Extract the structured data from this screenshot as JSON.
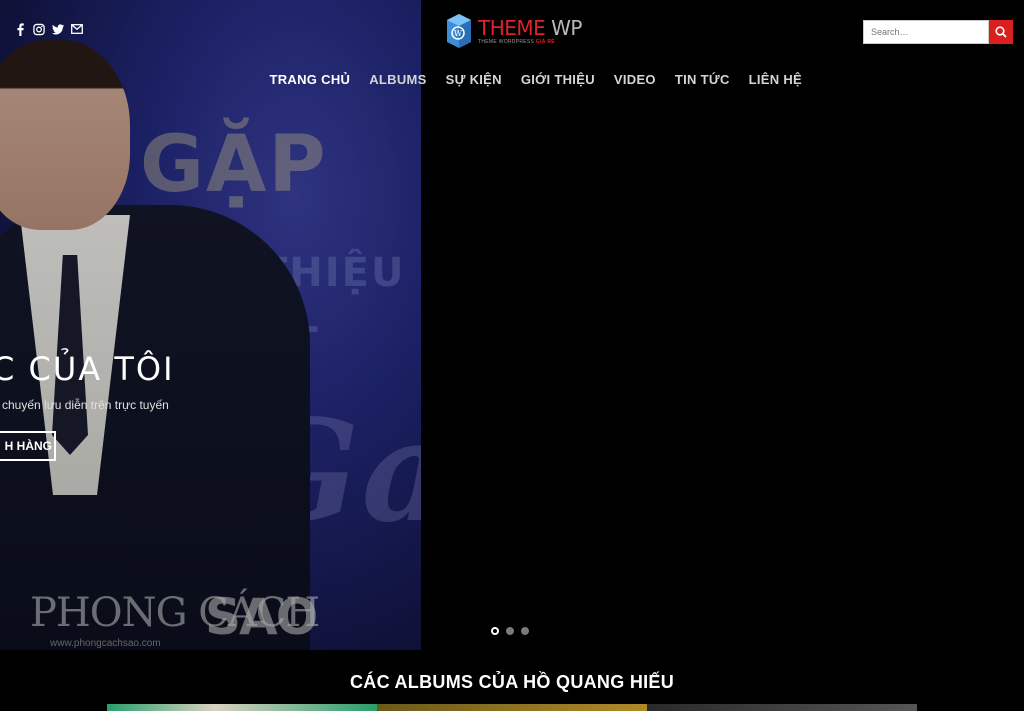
{
  "social": {
    "icons": [
      "facebook-icon",
      "instagram-icon",
      "twitter-icon",
      "email-icon"
    ]
  },
  "logo": {
    "name_theme": "THEME",
    "name_wp": "WP",
    "tagline_prefix": "THEME WORDPRESS",
    "tagline_accent": "GIÁ RẺ"
  },
  "search": {
    "placeholder": "Search…"
  },
  "nav": {
    "items": [
      "TRANG CHỦ",
      "ALBUMS",
      "SỰ KIỆN",
      "GIỚI THIỆU",
      "VIDEO",
      "TIN TỨC",
      "LIÊN HỆ"
    ],
    "active_index": 0
  },
  "slide": {
    "backdrop_text_1": "GẶP G",
    "backdrop_text_2": "THIỆU AL",
    "title": "C CỦA TÔI",
    "subtitle": "chuyến lưu diễn trên trực tuyến",
    "button_label": "H HÀNG",
    "watermark_text": "PHONG CÁCH",
    "watermark_brand": "SAO",
    "watermark_url": "www.phongcachsao.com"
  },
  "slider": {
    "dot_count": 3,
    "active_dot": 0
  },
  "albums_section": {
    "title": "CÁC ALBUMS CỦA HỒ QUANG HIẾU"
  },
  "colors": {
    "accent": "#d9201f",
    "background": "#000000"
  }
}
